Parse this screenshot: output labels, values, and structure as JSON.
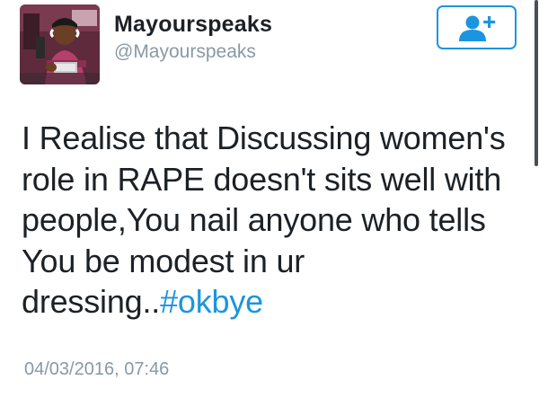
{
  "author": {
    "name": "Mayourspeaks",
    "handle": "@Mayourspeaks",
    "avatar_icon": "profile-photo"
  },
  "follow_button": {
    "icon": "add-user-icon",
    "color": "#1b95e0"
  },
  "tweet": {
    "lines": [
      "I Realise that Discussing women's",
      "role in RAPE doesn't sits well with",
      "people,You nail anyone who tells",
      "You be modest in ur"
    ],
    "last_line_text": "dressing..",
    "hashtag": "#okbye",
    "timestamp": "04/03/2016, 07:46"
  },
  "colors": {
    "text": "#1c2126",
    "muted": "#8899a6",
    "link": "#1b95e0"
  }
}
